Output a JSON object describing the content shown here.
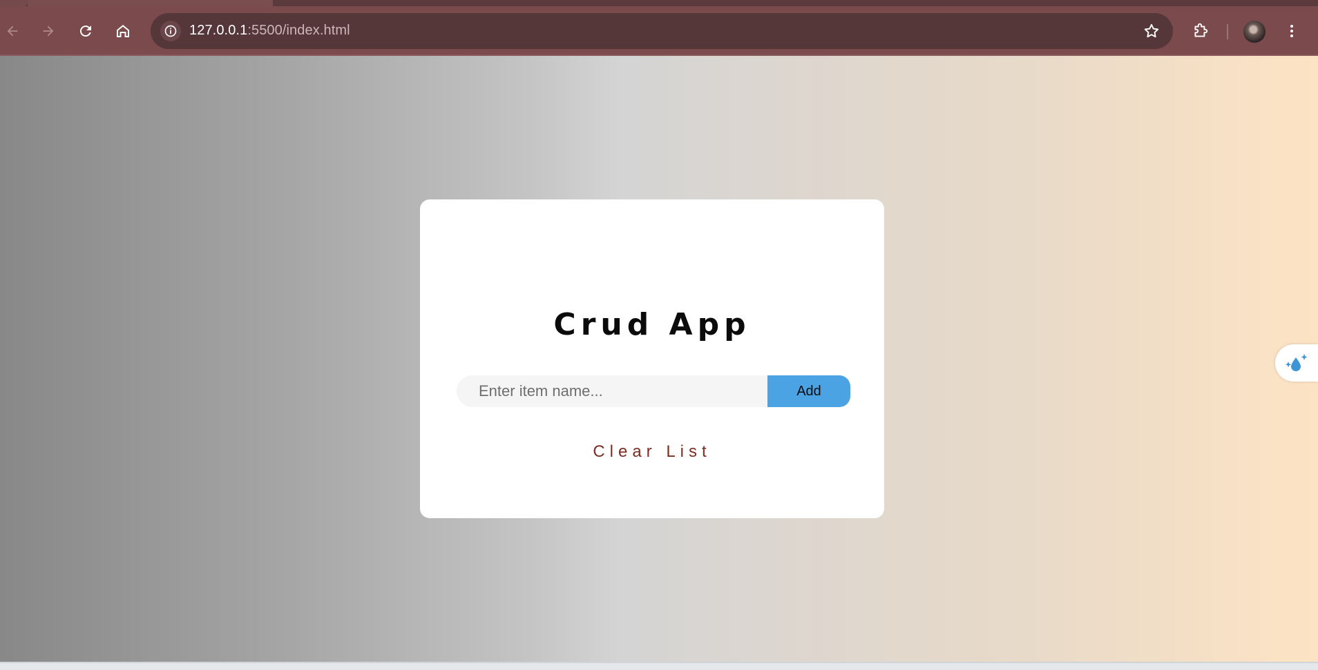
{
  "browser": {
    "url_host": "127.0.0.1",
    "url_path": ":5500/index.html",
    "icons": {
      "back": "back-arrow-icon",
      "forward": "forward-arrow-icon",
      "reload": "reload-icon",
      "home": "home-icon",
      "site_info": "info-icon",
      "bookmark": "star-icon",
      "extensions": "puzzle-icon",
      "profile": "avatar",
      "menu": "kebab-menu-icon"
    },
    "colors": {
      "toolbar": "#7a4a4c",
      "omnibox": "#55373a"
    }
  },
  "app": {
    "title": "Crud App",
    "input_placeholder": "Enter item name...",
    "input_value": "",
    "add_label": "Add",
    "clear_label": "Clear List",
    "colors": {
      "add_button": "#4ba3e3",
      "clear_text": "#7d2d22",
      "gradient_start": "#888888",
      "gradient_end": "#fde3c4"
    }
  },
  "side_widget": {
    "icon": "water-drop-sparkle-icon"
  }
}
